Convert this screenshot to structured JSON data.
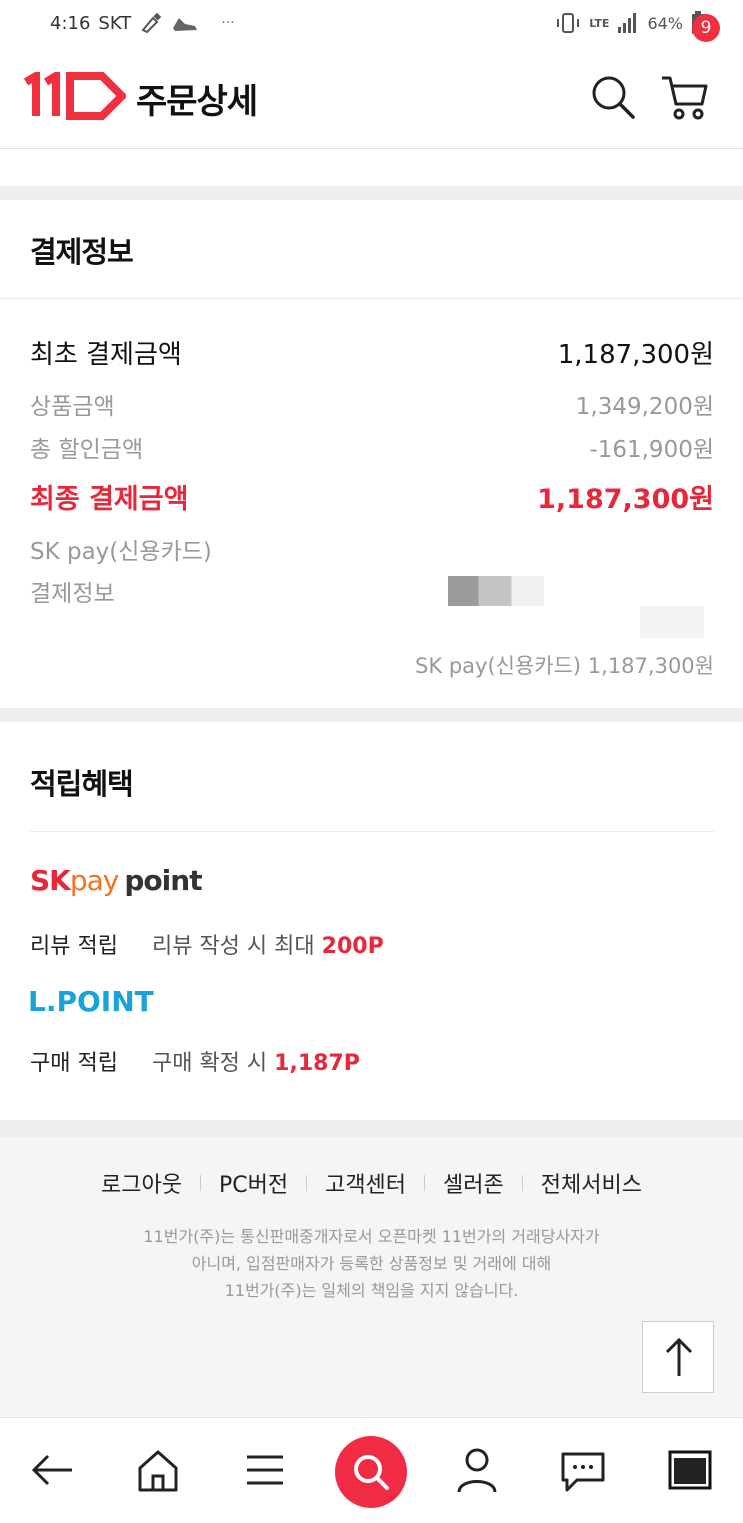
{
  "status_bar": {
    "time": "4:16",
    "carrier": "SKT",
    "more": "···",
    "network": "LTE",
    "battery": "64%"
  },
  "header": {
    "title": "주문상세",
    "cart_count": "9"
  },
  "payment": {
    "section_title": "결제정보",
    "initial_label": "최초 결제금액",
    "initial_value": "1,187,300원",
    "product_label": "상품금액",
    "product_value": "1,349,200원",
    "discount_label": "총 할인금액",
    "discount_value": "-161,900원",
    "final_label": "최종 결제금액",
    "final_value": "1,187,300원",
    "method_label": "SK pay(신용카드)",
    "info_label": "결제정보",
    "summary": "SK pay(신용카드) 1,187,300원"
  },
  "reward": {
    "section_title": "적립혜택",
    "sk_brand_sk": "SK",
    "sk_brand_pay": "pay",
    "sk_brand_point": "point",
    "review_label": "리뷰 적립",
    "review_desc": "리뷰 작성 시 최대",
    "review_point": "200P",
    "lpoint_brand": "L.POINT",
    "purchase_label": "구매 적립",
    "purchase_desc": "구매 확정 시",
    "purchase_point": "1,187P"
  },
  "footer": {
    "links": [
      "로그아웃",
      "PC버전",
      "고객센터",
      "셀러존",
      "전체서비스"
    ],
    "note_line1": "11번가(주)는 통신판매중개자로서 오픈마켓 11번가의 거래당사자가",
    "note_line2": "아니며, 입점판매자가 등록한 상품정보 및 거래에 대해",
    "note_line3": "11번가(주)는 일체의 책임을 지지 않습니다."
  },
  "colors": {
    "brand_red": "#f0303f",
    "price_red": "#e8283a",
    "sk_orange": "#f37321",
    "lpoint_blue": "#1aa3d9"
  },
  "icons": {
    "logo": "11st-logo",
    "search": "search-icon",
    "cart": "cart-icon",
    "back": "arrow-left-icon",
    "home": "home-icon",
    "menu": "menu-icon",
    "my": "user-icon",
    "talk": "chat-icon",
    "tabs": "tabs-icon",
    "top": "arrow-up-icon"
  }
}
